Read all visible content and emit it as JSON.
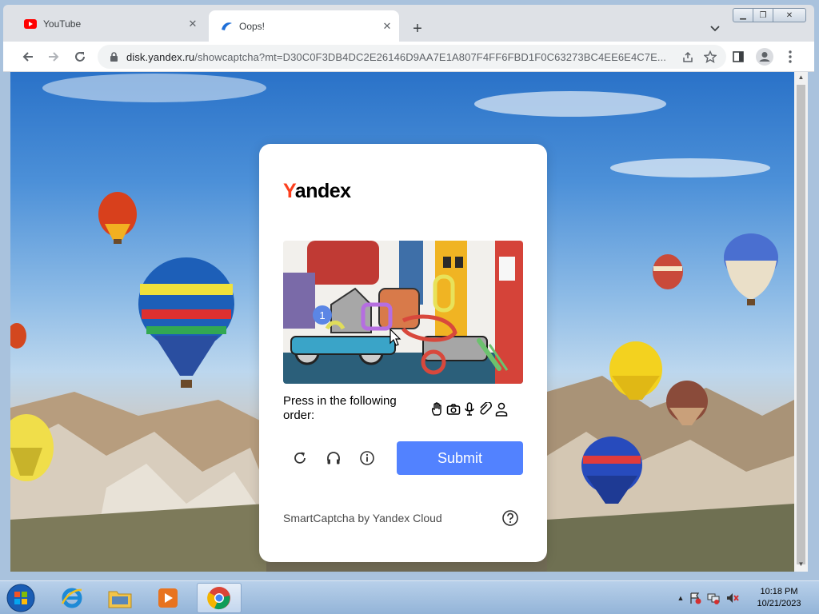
{
  "browser": {
    "tabs": [
      {
        "title": "YouTube",
        "icon": "youtube-icon",
        "active": false
      },
      {
        "title": "Oops!",
        "icon": "yandex-cloud-icon",
        "active": true
      }
    ],
    "url_domain": "disk.yandex.ru",
    "url_rest": "/showcaptcha?mt=D30C0F3DB4DC2E26146D9AA7E1A807F4FF6FBD1F0C63273BC4EE6E4C7E..."
  },
  "captcha": {
    "logo_first": "Y",
    "logo_rest": "andex",
    "instruction": "Press in the following order:",
    "order_icons": [
      "hand-icon",
      "camera-icon",
      "microphone-icon",
      "paperclip-icon",
      "person-icon"
    ],
    "submit_label": "Submit",
    "footer": "SmartCaptcha by Yandex Cloud",
    "marker_number": "1",
    "accent_color": "#5282ff"
  },
  "taskbar": {
    "time": "10:18 PM",
    "date": "10/21/2023",
    "apps": [
      "internet-explorer-icon",
      "file-explorer-icon",
      "media-player-icon",
      "chrome-icon"
    ]
  }
}
